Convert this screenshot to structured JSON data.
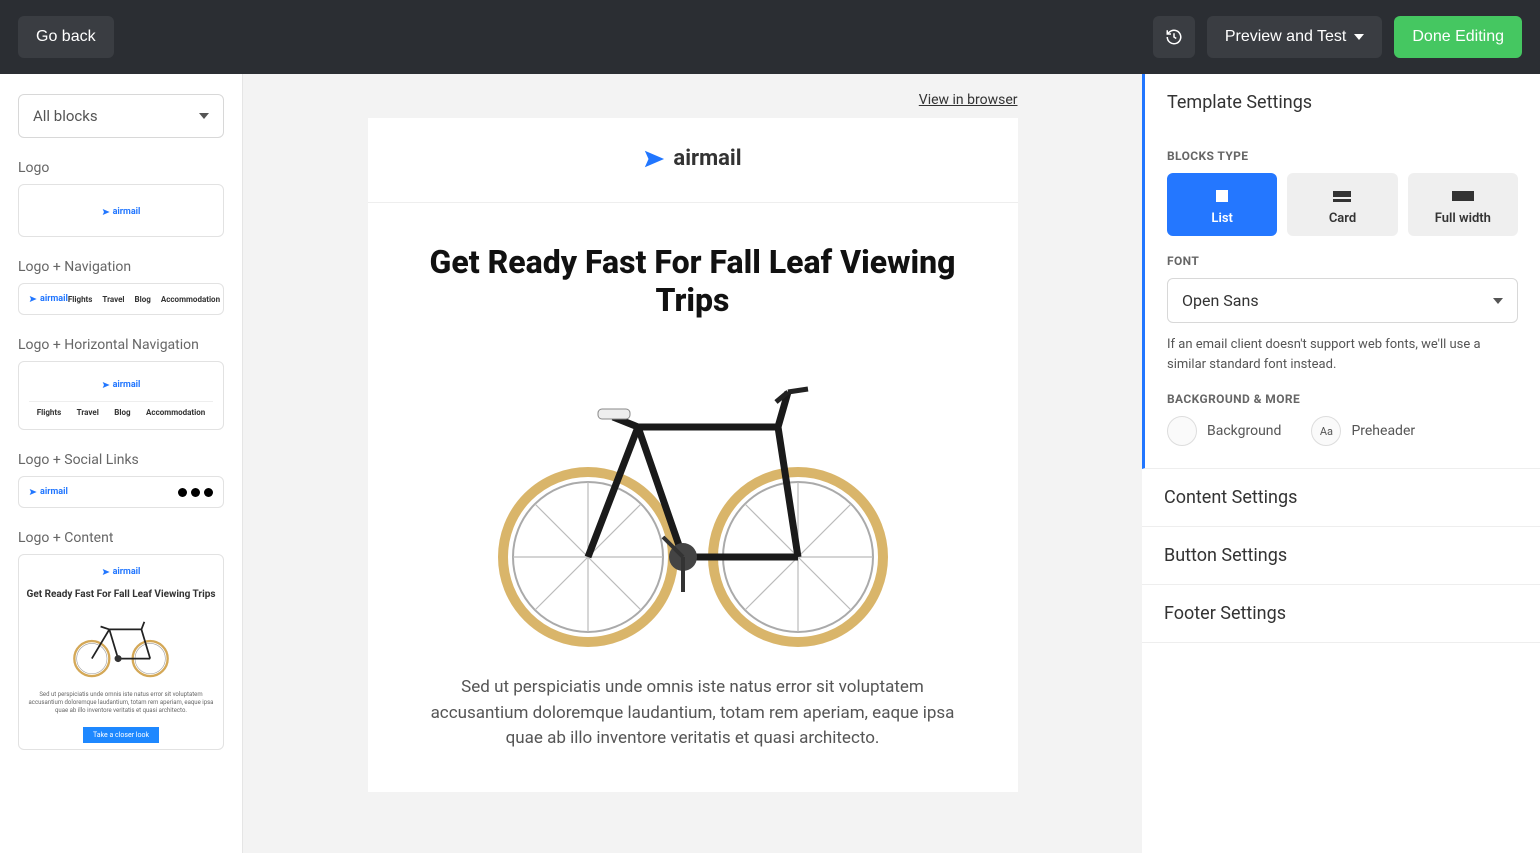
{
  "topbar": {
    "go_back": "Go back",
    "preview_test": "Preview and Test",
    "done_editing": "Done Editing"
  },
  "left_sidebar": {
    "filter_dropdown": "All blocks",
    "blocks": [
      {
        "label": "Logo"
      },
      {
        "label": "Logo + Navigation",
        "nav": [
          "Flights",
          "Travel",
          "Blog",
          "Accommodation"
        ]
      },
      {
        "label": "Logo + Horizontal Navigation",
        "nav": [
          "Flights",
          "Travel",
          "Blog",
          "Accommodation"
        ]
      },
      {
        "label": "Logo + Social Links"
      },
      {
        "label": "Logo + Content",
        "headline": "Get Ready Fast For Fall Leaf Viewing Trips",
        "lorem": "Sed ut perspiciatis unde omnis iste natus error sit voluptatem accusantium doloremque laudantium, totam rem aperiam, eaque ipsa quae ab illo inventore veritatis et quasi architecto.",
        "cta": "Take a closer look"
      }
    ]
  },
  "brand": {
    "name": "airmail"
  },
  "email": {
    "view_in_browser": "View in browser",
    "headline": "Get Ready Fast For Fall Leaf Viewing Trips",
    "body_text": "Sed ut perspiciatis unde omnis iste natus error sit voluptatem accusantium doloremque laudantium, totam rem aperiam, eaque ipsa quae ab illo inventore veritatis et quasi architecto."
  },
  "right_sidebar": {
    "sections": {
      "template": "Template Settings",
      "content": "Content Settings",
      "button": "Button Settings",
      "footer": "Footer Settings"
    },
    "blocks_type_label": "BLOCKS TYPE",
    "block_types": {
      "list": "List",
      "card": "Card",
      "full_width": "Full width"
    },
    "font_label": "FONT",
    "font_value": "Open Sans",
    "font_note": "If an email client doesn't support web fonts, we'll use a similar standard font instead.",
    "bg_label": "BACKGROUND & MORE",
    "bg_options": {
      "background": "Background",
      "preheader": "Preheader"
    },
    "preheader_icon": "Aa"
  }
}
